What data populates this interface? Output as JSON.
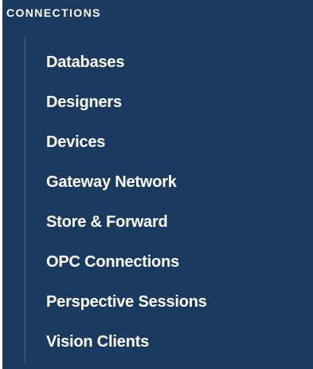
{
  "section": {
    "title": "CONNECTIONS"
  },
  "nav": {
    "items": [
      {
        "label": "Databases"
      },
      {
        "label": "Designers"
      },
      {
        "label": "Devices"
      },
      {
        "label": "Gateway Network"
      },
      {
        "label": "Store & Forward"
      },
      {
        "label": "OPC Connections"
      },
      {
        "label": "Perspective Sessions"
      },
      {
        "label": "Vision Clients"
      }
    ]
  },
  "colors": {
    "panel_background": "#1b3a5f",
    "rail": "#2f5480",
    "text": "#ffffff"
  }
}
